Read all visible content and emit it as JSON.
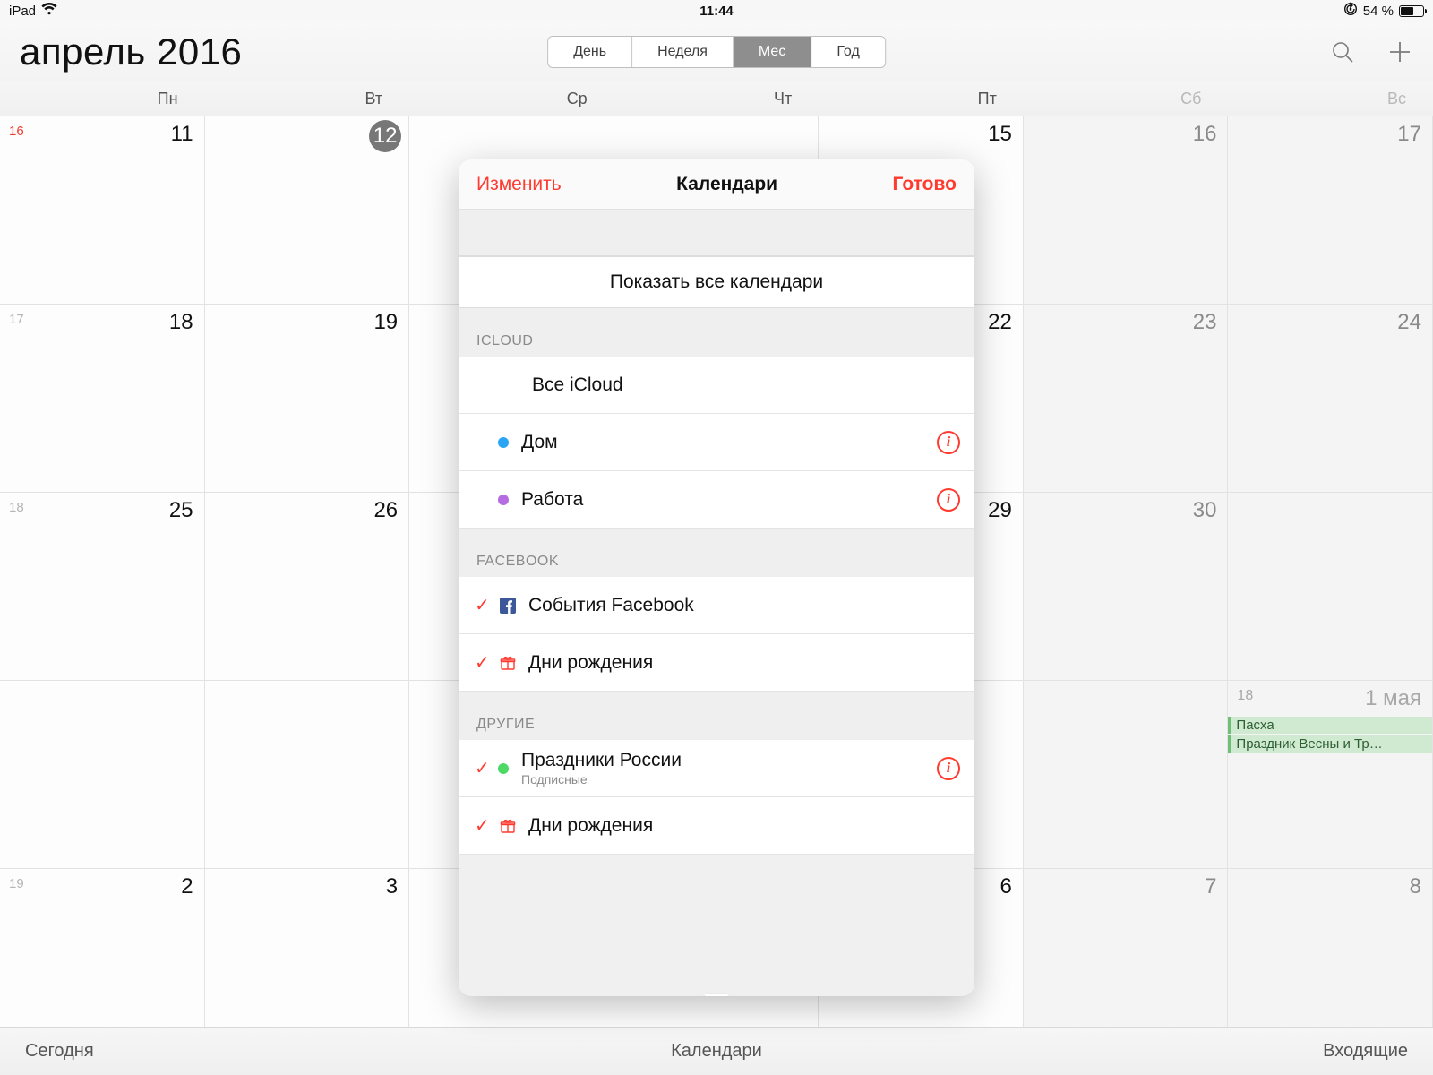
{
  "statusbar": {
    "device": "iPad",
    "time": "11:44",
    "battery_text": "54 %"
  },
  "header": {
    "month_title": "апрель 2016",
    "seg": {
      "day": "День",
      "week": "Неделя",
      "month": "Мес",
      "year": "Год"
    }
  },
  "weekdays": [
    "Пн",
    "Вт",
    "Ср",
    "Чт",
    "Пт",
    "Сб",
    "Вс"
  ],
  "grid": {
    "rows": [
      {
        "weeknum": "16",
        "red_weeknum": true,
        "days": [
          "11",
          "12",
          "",
          "",
          "15",
          "16",
          "17"
        ],
        "today_col": 1
      },
      {
        "weeknum": "17",
        "days": [
          "18",
          "19",
          "",
          "",
          "22",
          "23",
          "24"
        ]
      },
      {
        "weeknum": "18",
        "days": [
          "25",
          "26",
          "",
          "",
          "29",
          "30",
          ""
        ],
        "last_is_may": true
      },
      {
        "weeknum": "",
        "days": [
          "",
          "",
          "",
          "",
          "",
          "",
          ""
        ],
        "may_overflow": "18",
        "may_label": "1 мая",
        "events": [
          "Пасха",
          "Праздник Весны и Тр…"
        ]
      },
      {
        "weeknum": "19",
        "days": [
          "2",
          "3",
          "",
          "",
          "6",
          "7",
          "8"
        ]
      }
    ]
  },
  "toolbar": {
    "today": "Сегодня",
    "calendars": "Календари",
    "inbox": "Входящие"
  },
  "popover": {
    "edit": "Изменить",
    "title": "Календари",
    "done": "Готово",
    "show_all": "Показать все календари",
    "sections": [
      {
        "name": "ICLOUD",
        "items": [
          {
            "label": "Все iCloud",
            "checked": false,
            "dot": null,
            "info": false,
            "indent": true
          },
          {
            "label": "Дом",
            "checked": false,
            "dot": "#2aa4f4",
            "info": true
          },
          {
            "label": "Работа",
            "checked": false,
            "dot": "#b56ce2",
            "info": true
          }
        ]
      },
      {
        "name": "FACEBOOK",
        "items": [
          {
            "label": "События Facebook",
            "checked": true,
            "icon": "fb",
            "info": false
          },
          {
            "label": "Дни рождения",
            "checked": true,
            "icon": "gift",
            "info": false
          }
        ]
      },
      {
        "name": "ДРУГИЕ",
        "items": [
          {
            "label": "Праздники России",
            "sub": "Подписные",
            "checked": true,
            "dot": "#4cd964",
            "info": true
          },
          {
            "label": "Дни рождения",
            "checked": true,
            "icon": "gift",
            "info": false
          }
        ]
      }
    ]
  }
}
